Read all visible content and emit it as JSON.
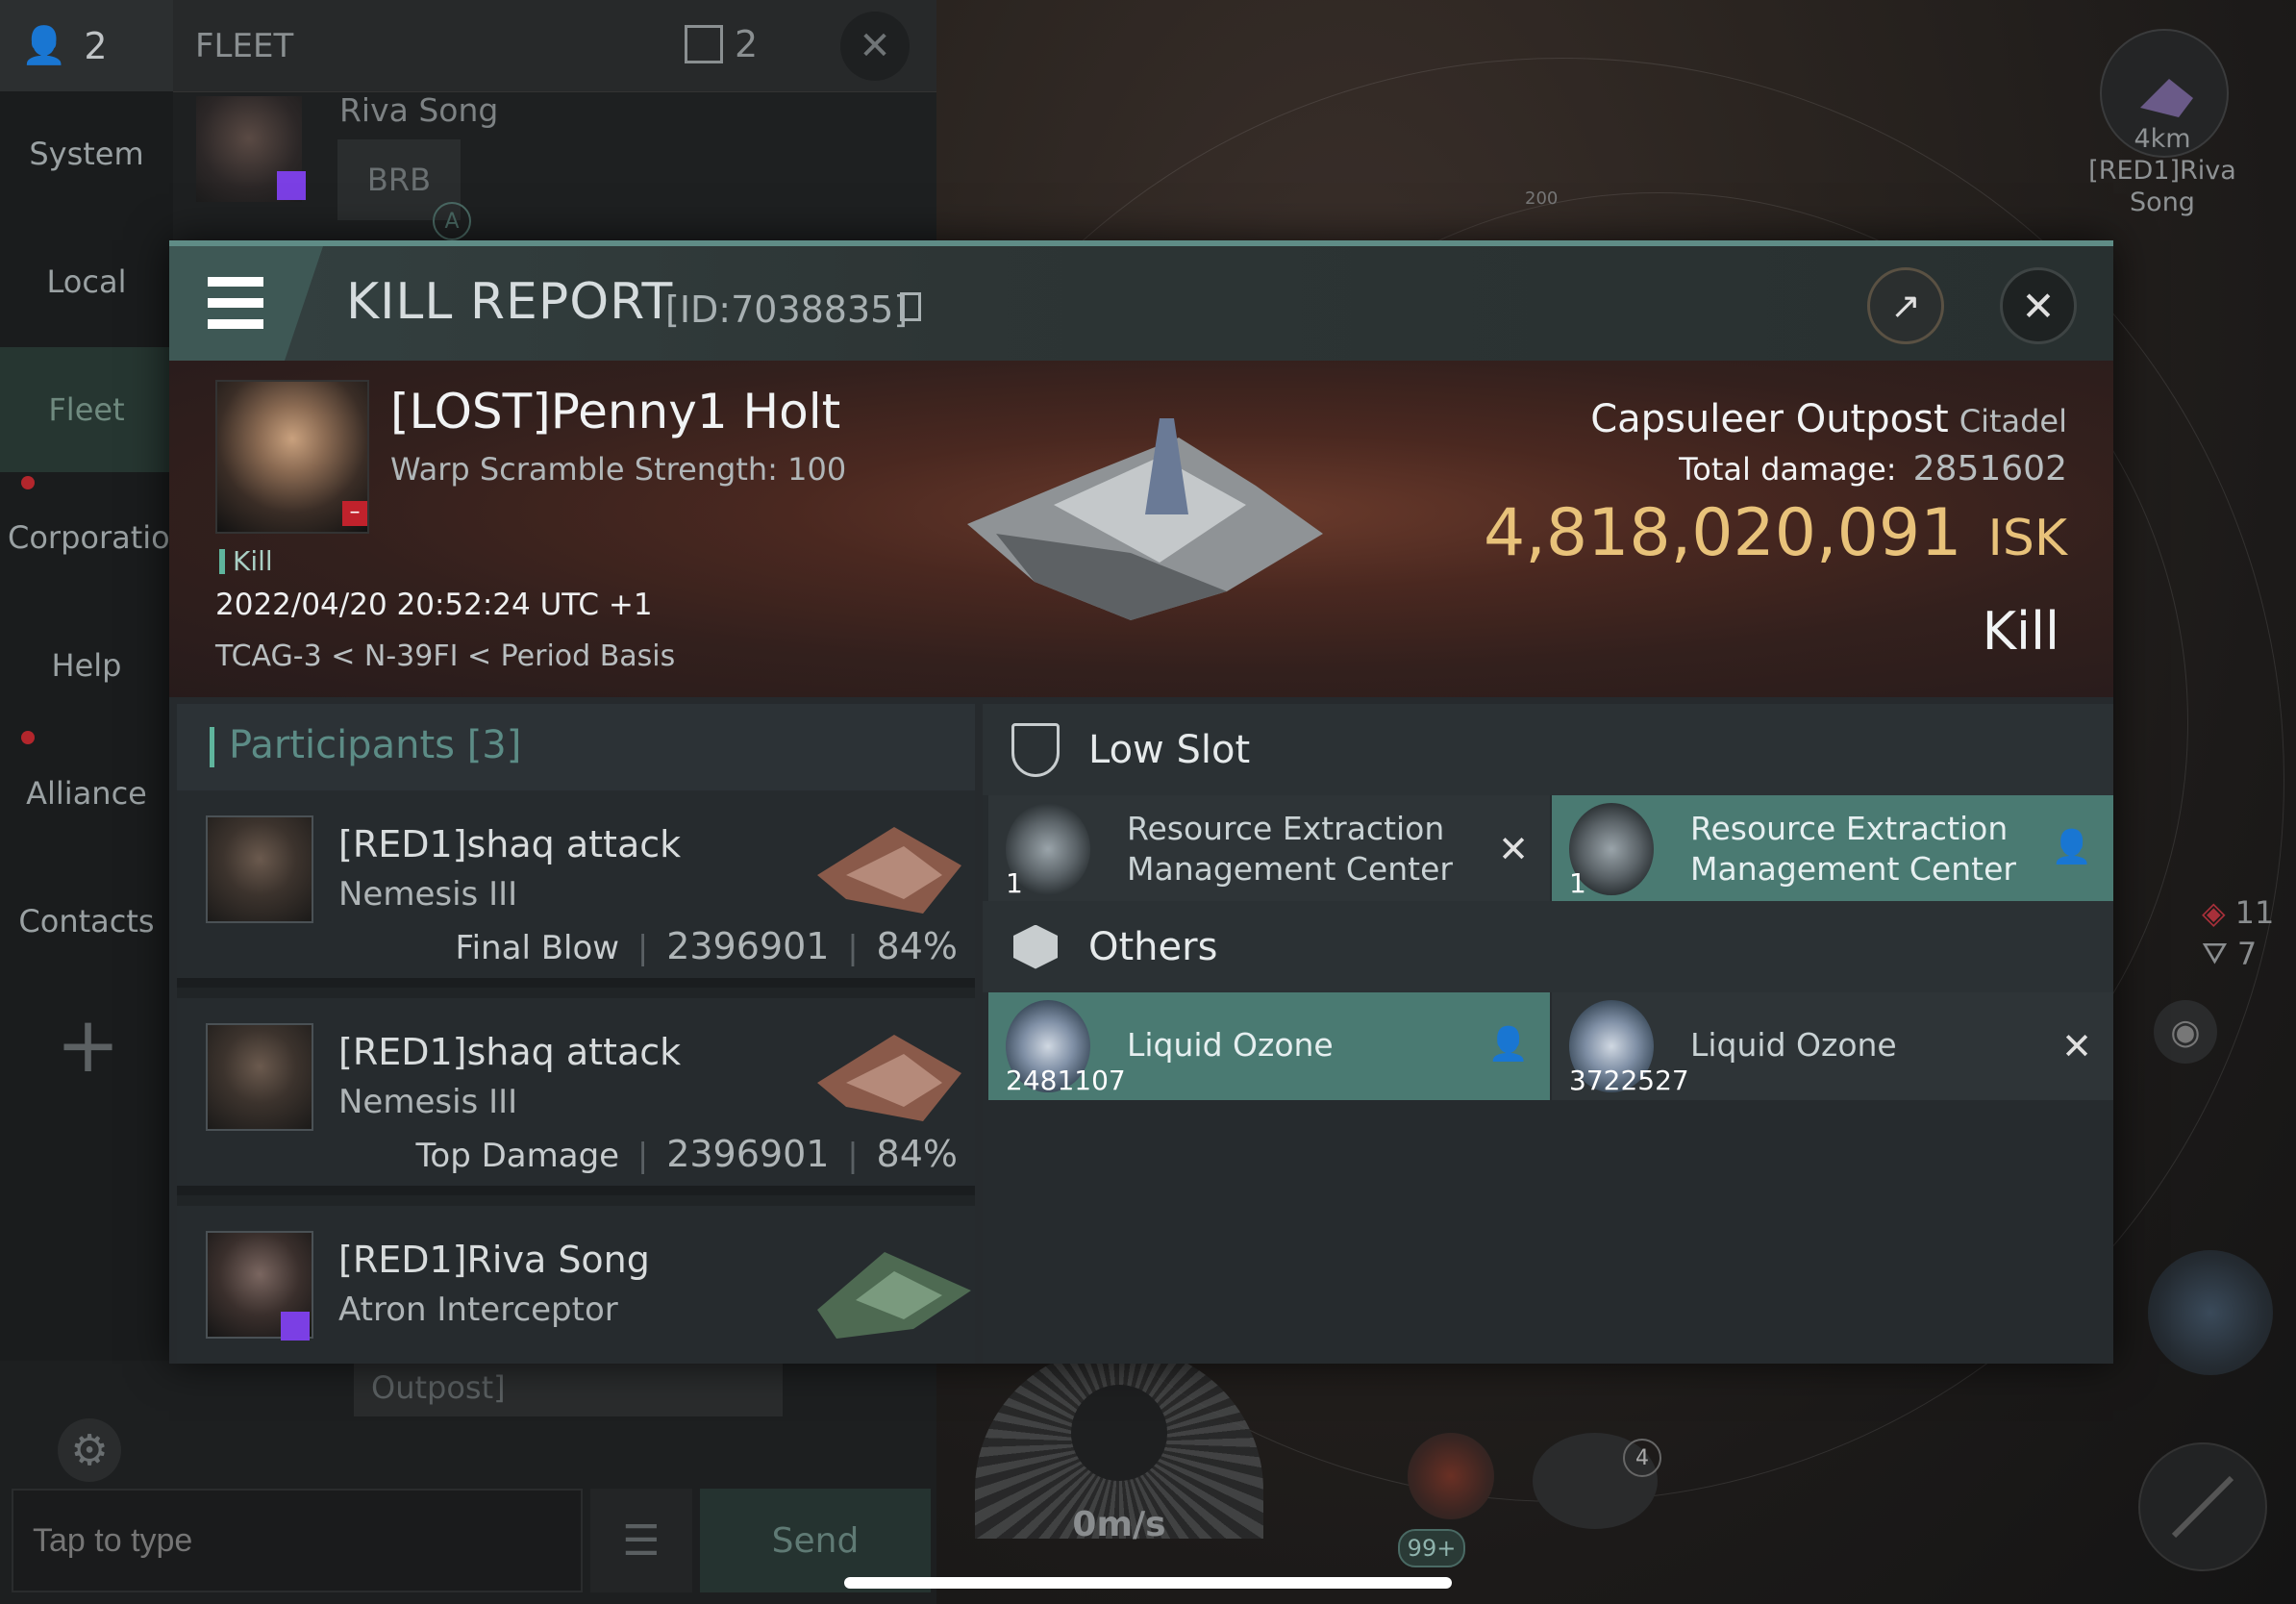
{
  "fleet_bar": {
    "member_count": "2",
    "title": "FLEET",
    "squad_count": "2"
  },
  "fleet_member": {
    "name": "Riva Song",
    "broadcast": "BRB",
    "badge": "A"
  },
  "nav": {
    "items": [
      "System",
      "Local",
      "Fleet",
      "Corporation",
      "Help",
      "Alliance",
      "Contacts"
    ]
  },
  "chat": {
    "input_placeholder": "Tap to type",
    "send_label": "Send",
    "outpost_fragment": "Outpost]"
  },
  "hud": {
    "speed": "0m/s",
    "range_label": "200",
    "target_distance": "4km",
    "target_name_line1": "[RED1]Riva",
    "target_name_line2": "Song",
    "count_red": "11",
    "count_gray": "7",
    "slot_badge": "4",
    "overflow_badge": "99+"
  },
  "kill_report": {
    "title": "KILL REPORT",
    "report_id": "[ID:7038835]",
    "victim": {
      "name": "[LOST]Penny1 Holt",
      "warp_scramble": "Warp Scramble Strength: 100",
      "kill_tag": "Kill",
      "timestamp": "2022/04/20 20:52:24 UTC +1",
      "location": "TCAG-3 < N-39FI < Period Basis"
    },
    "target": {
      "name": "Capsuleer Outpost",
      "class": "Citadel",
      "total_damage_label": "Total damage:",
      "total_damage_value": "2851602",
      "isk_value": "4,818,020,091",
      "isk_unit": "ISK",
      "result": "Kill"
    },
    "participants": {
      "header": "Participants",
      "count": "[3]",
      "rows": [
        {
          "name": "[RED1]shaq attack",
          "ship": "Nemesis III",
          "role": "Final Blow",
          "damage": "2396901",
          "percent": "84%"
        },
        {
          "name": "[RED1]shaq attack",
          "ship": "Nemesis III",
          "role": "Top Damage",
          "damage": "2396901",
          "percent": "84%"
        },
        {
          "name": "[RED1]Riva Song",
          "ship": "Atron Interceptor",
          "role": "",
          "damage": "",
          "percent": ""
        }
      ]
    },
    "low_slot": {
      "header": "Low Slot",
      "items": [
        {
          "line1": "Resource Extraction",
          "line2": "Management Center",
          "qty": "1",
          "status": "destroyed"
        },
        {
          "line1": "Resource Extraction",
          "line2": "Management Center",
          "qty": "1",
          "status": "dropped"
        }
      ]
    },
    "others": {
      "header": "Others",
      "items": [
        {
          "name": "Liquid Ozone",
          "qty": "2481107",
          "status": "dropped"
        },
        {
          "name": "Liquid Ozone",
          "qty": "3722527",
          "status": "destroyed"
        }
      ]
    }
  },
  "colors": {
    "accent_teal": "#4a7a72",
    "isk_gold": "#e8c27a",
    "alert_red": "#b3262c",
    "corp_purple": "#7b3fe4"
  }
}
